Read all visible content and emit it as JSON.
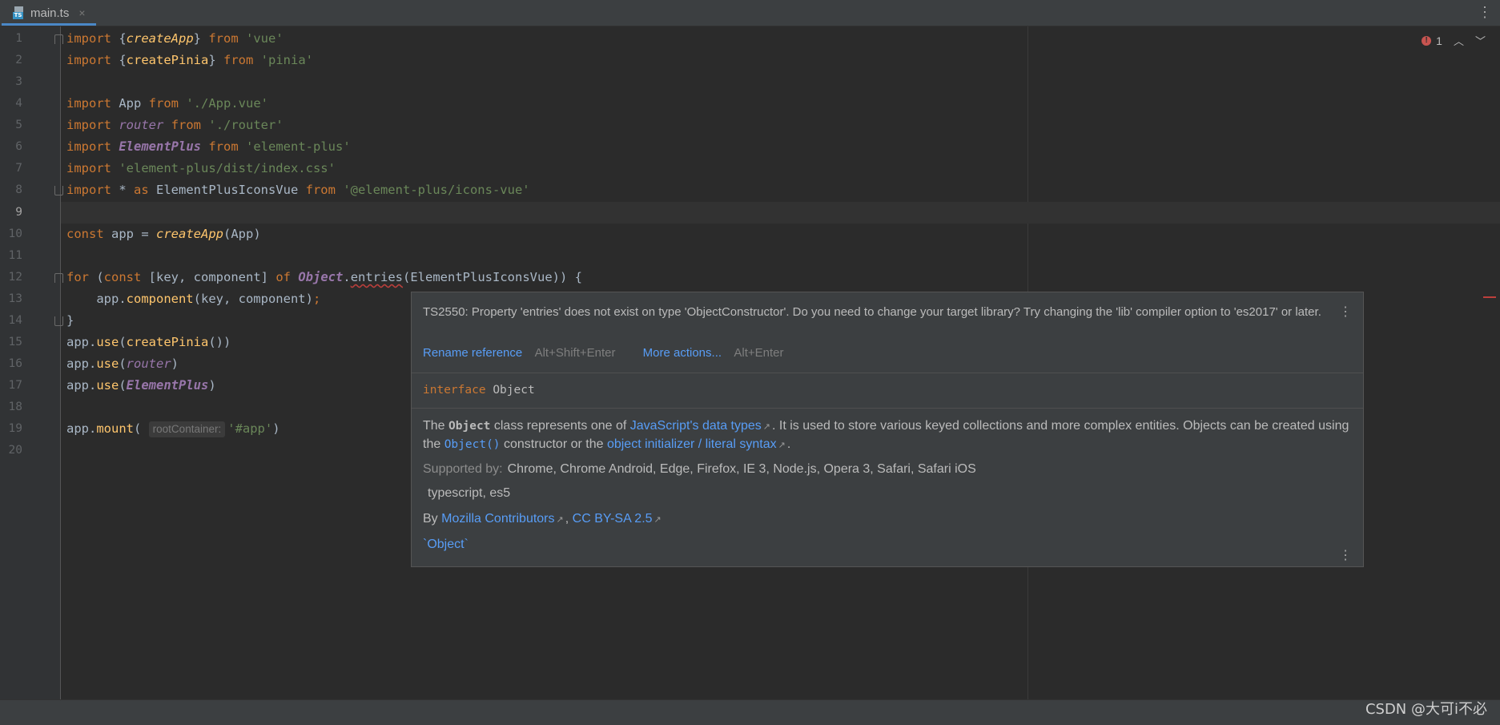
{
  "tab": {
    "label": "main.ts",
    "close": "×",
    "icon": "typescript-file-icon",
    "badge": "TS"
  },
  "problems": {
    "count": "1"
  },
  "code": {
    "lines": [
      "1",
      "2",
      "3",
      "4",
      "5",
      "6",
      "7",
      "8",
      "9",
      "10",
      "11",
      "12",
      "13",
      "14",
      "15",
      "16",
      "17",
      "18",
      "19",
      "20"
    ],
    "current_line": "9",
    "hint_label": "rootContainer:"
  },
  "popup": {
    "error": "TS2550: Property 'entries' does not exist on type 'ObjectConstructor'. Do you need to change your target library? Try changing the 'lib' compiler option to 'es2017' or later.",
    "rename_label": "Rename reference",
    "rename_shortcut": "Alt+Shift+Enter",
    "more_label": "More actions...",
    "more_shortcut": "Alt+Enter",
    "sig_kw": "interface",
    "sig_name": "Object",
    "doc": {
      "t1": "The",
      "code1": "Object",
      "t2": "class represents one of",
      "link1": "JavaScript's data types",
      "t3": ". It is used to store various keyed collections and more complex entities. Objects can be created using the",
      "code2": "Object()",
      "t4": "constructor or the",
      "link2": "object initializer / literal syntax",
      "t5": "."
    },
    "supported_label": "Supported by:",
    "supported_value": "Chrome, Chrome Android, Edge, Firefox, IE 3, Node.js, Opera 3, Safari, Safari iOS",
    "supported_extra": "typescript, es5",
    "by_label": "By",
    "by_link1": "Mozilla Contributors",
    "by_sep": ",",
    "by_link2": "CC BY-SA 2.5",
    "obj_link": "`Object`"
  },
  "watermark": "CSDN @大可i不必"
}
